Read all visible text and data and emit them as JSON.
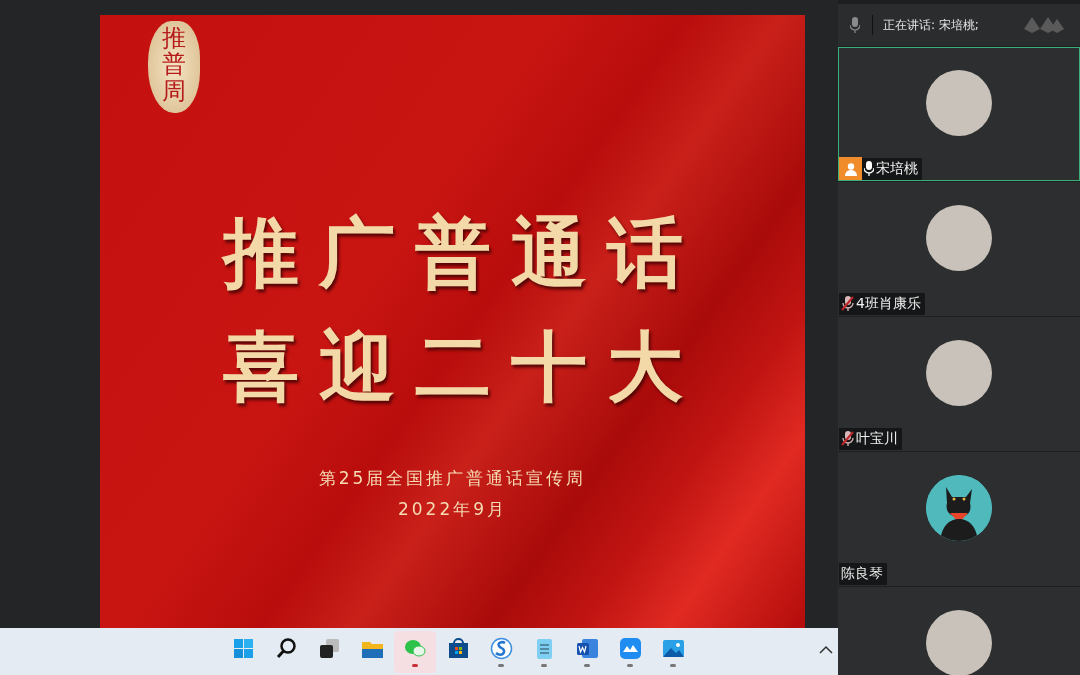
{
  "slide": {
    "seal": "推普周",
    "title_lines": [
      "推广普通话",
      "喜迎二十大"
    ],
    "subtitle": "第25届全国推广普通话宣传周",
    "date": "2022年9月"
  },
  "taskbar": {
    "icons": [
      {
        "kind": "start",
        "running": false,
        "selected": false
      },
      {
        "kind": "search",
        "running": false,
        "selected": false
      },
      {
        "kind": "taskview",
        "running": false,
        "selected": false
      },
      {
        "kind": "folder",
        "running": false,
        "selected": false
      },
      {
        "kind": "chat",
        "running": true,
        "selected": true
      },
      {
        "kind": "store",
        "running": false,
        "selected": false
      },
      {
        "kind": "browser",
        "running": true,
        "selected": false
      },
      {
        "kind": "notepad",
        "running": true,
        "selected": false
      },
      {
        "kind": "word",
        "running": true,
        "selected": false
      },
      {
        "kind": "meeting",
        "running": true,
        "selected": false
      },
      {
        "kind": "photos",
        "running": true,
        "selected": false
      }
    ]
  },
  "speaker_bar": {
    "text": "正在讲话: 宋培桃;"
  },
  "participants": [
    {
      "kind": "photo",
      "name": "宋培桃",
      "speaking": true,
      "muted": false,
      "host": true,
      "active": true
    },
    {
      "kind": "photo",
      "name": "4班肖康乐",
      "speaking": false,
      "muted": true,
      "host": false,
      "active": false
    },
    {
      "kind": "photo",
      "name": "叶宝川",
      "speaking": false,
      "muted": true,
      "host": false,
      "active": false
    },
    {
      "kind": "cartoon",
      "name": "陈良琴",
      "speaking": false,
      "muted": false,
      "host": false,
      "active": false
    },
    {
      "kind": "photo",
      "speaking": false,
      "muted": false,
      "host": false,
      "active": false
    }
  ]
}
